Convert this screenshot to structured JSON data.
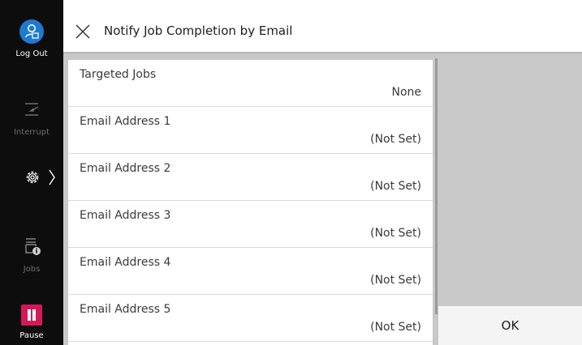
{
  "sidebar": {
    "logout_label": "Log Out",
    "interrupt_label": "Interrupt",
    "jobs_label": "Jobs",
    "pause_label": "Pause",
    "icons": [
      "logout-user-icon",
      "interrupt-icon",
      "settings-gear-icon",
      "chevron-right-icon",
      "jobs-printer-icon",
      "pause-icon"
    ],
    "colors": {
      "background": "#0d0d0d",
      "logout_accent": "#1c7ad2",
      "pause_accent": "#d4195b"
    }
  },
  "header": {
    "title": "Notify Job Completion by Email",
    "close_icon": "close-icon"
  },
  "list": {
    "items": [
      {
        "label": "Targeted Jobs",
        "value": "None"
      },
      {
        "label": "Email Address 1",
        "value": "(Not Set)"
      },
      {
        "label": "Email Address 2",
        "value": "(Not Set)"
      },
      {
        "label": "Email Address 3",
        "value": "(Not Set)"
      },
      {
        "label": "Email Address 4",
        "value": "(Not Set)"
      },
      {
        "label": "Email Address 5",
        "value": "(Not Set)"
      }
    ]
  },
  "actions": {
    "ok_label": "OK"
  }
}
